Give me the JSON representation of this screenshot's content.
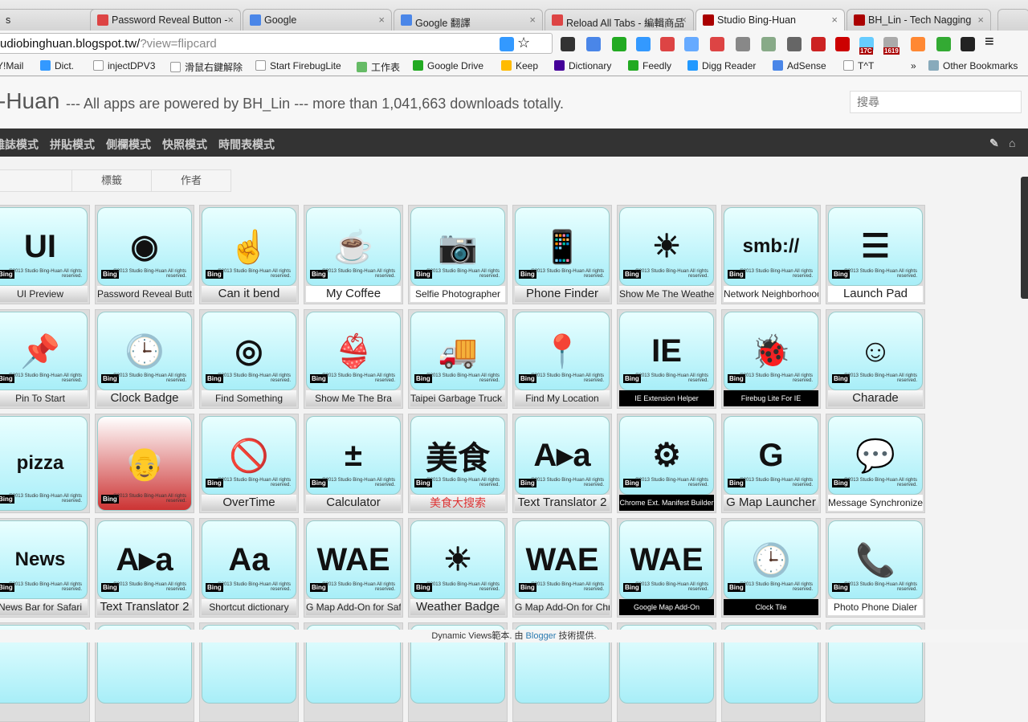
{
  "browser": {
    "tabs": [
      {
        "title": "s",
        "color": "#999"
      },
      {
        "title": "Password Reveal Button - ",
        "color": "#d44"
      },
      {
        "title": "Google",
        "color": "#4a86e8"
      },
      {
        "title": "Google 翻譯",
        "color": "#4a86e8"
      },
      {
        "title": "Reload All Tabs - 編輯商品",
        "color": "#d44"
      },
      {
        "title": "Studio Bing-Huan",
        "color": "#a00",
        "active": true
      },
      {
        "title": "BH_Lin - Tech Nagging",
        "color": "#a00"
      }
    ],
    "url_host": "udiobinghuan.blogspot.tw/",
    "url_query": "?view=flipcard",
    "bookmarks": [
      "Y!Mail",
      "Dict.",
      "injectDPV3",
      "滑鼠右鍵解除",
      "Start FirebugLite",
      "工作表",
      "Google Drive",
      "Keep",
      "Dictionary",
      "Feedly",
      "Digg Reader",
      "AdSense",
      "T^T"
    ],
    "more": "»",
    "other_bookmarks": "Other Bookmarks",
    "badges": [
      "17C",
      "1619"
    ]
  },
  "header": {
    "title": "-Huan",
    "subtitle": "--- All apps are powered by BH_Lin --- more than 1,041,663 downloads totally.",
    "search_placeholder": "搜尋"
  },
  "nav": {
    "items": [
      "雜誌模式",
      "拼貼模式",
      "側欄模式",
      "快照模式",
      "時間表模式"
    ]
  },
  "filters": [
    "",
    "標籤",
    "作者"
  ],
  "cards": [
    [
      "UI Preview",
      "Password Reveal Button",
      "Can it bend",
      "My Coffee",
      "Selfie Photographer",
      "Phone Finder",
      "Show Me The Weather",
      "Network Neighborhood Linker",
      "Launch Pad"
    ],
    [
      "Pin To Start",
      "Clock Badge",
      "Find Something",
      "Show Me The Bra",
      "Taipei Garbage Truck Finder",
      "Find My Location",
      "IE Extension Helper",
      "Firebug Lite For IE",
      "Charade"
    ],
    [
      "",
      "",
      "OverTime",
      "Calculator",
      "美食大搜索",
      "Text Translator 2",
      "Chrome Ext. Manifest Builder",
      "G Map Launcher",
      "Message Synchronizer"
    ],
    [
      "News Bar for Safari",
      "Text Translator 2",
      "Shortcut dictionary",
      "G Map Add-On for Safari",
      "Weather Badge",
      "G Map Add-On for Chrome",
      "Google Map Add-On",
      "Clock Tile",
      "Photo Phone Dialer"
    ]
  ],
  "icon_glyphs": [
    [
      "UI",
      "◉",
      "☝",
      "☕",
      "📷",
      "📱",
      "☀",
      "smb://",
      "☰"
    ],
    [
      "📌",
      "🕒",
      "◎",
      "👙",
      "🚚",
      "📍",
      "IE",
      "🐞",
      "☺"
    ],
    [
      "pizza",
      "👴",
      "🚫",
      "±",
      "美食",
      "A▸a",
      "⚙",
      "G",
      "💬"
    ],
    [
      "News",
      "A▸a",
      "Aa",
      "WAE",
      "☀",
      "WAE",
      "WAE",
      "🕒",
      "📞"
    ]
  ],
  "card_brand": "Bing",
  "card_copyright": "©2013 Studio Bing-Huan All rights reserved.",
  "footer": {
    "prefix": "Dynamic Views範本. 由 ",
    "link": "Blogger",
    "suffix": " 技術提供."
  }
}
